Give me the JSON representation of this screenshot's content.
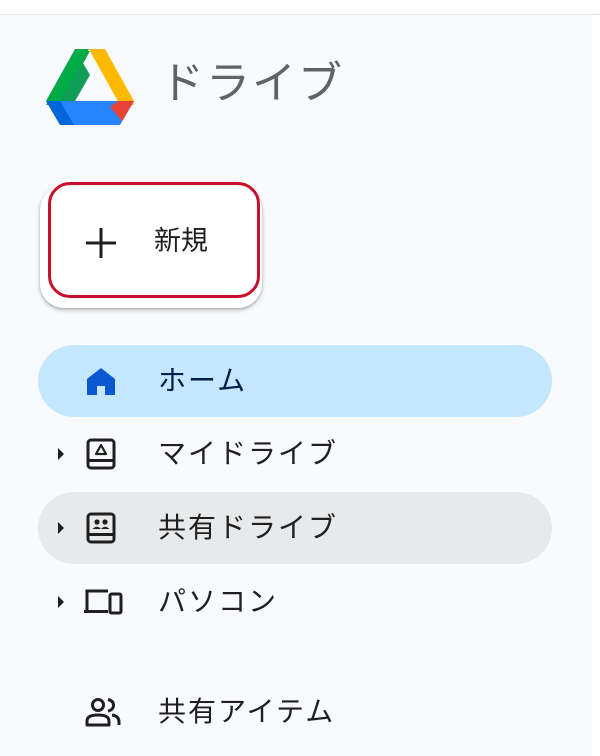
{
  "app": {
    "title": "ドライブ",
    "logo_icon": "google-drive-logo"
  },
  "new_button": {
    "label": "新規",
    "icon": "plus-icon",
    "highlight_color": "#c8102e"
  },
  "nav": {
    "items": [
      {
        "label": "ホーム",
        "icon": "home-icon",
        "state": "active",
        "has_caret": false
      },
      {
        "label": "マイドライブ",
        "icon": "my-drive-icon",
        "state": "normal",
        "has_caret": true
      },
      {
        "label": "共有ドライブ",
        "icon": "shared-drive-icon",
        "state": "hover",
        "has_caret": true
      },
      {
        "label": "パソコン",
        "icon": "computers-icon",
        "state": "normal",
        "has_caret": true
      },
      {
        "label": "共有アイテム",
        "icon": "shared-with-me-icon",
        "state": "normal",
        "has_caret": false
      }
    ]
  },
  "colors": {
    "active_bg": "#c2e7ff",
    "hover_bg": "#e8e9ea",
    "active_icon": "#0b57d0",
    "page_bg": "#f8fafd"
  }
}
